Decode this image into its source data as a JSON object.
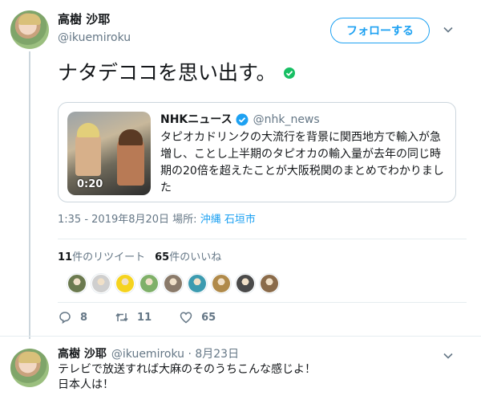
{
  "tweet": {
    "display_name": "高樹 沙耶",
    "handle": "@ikuemiroku",
    "follow_label": "フォローする",
    "text": "ナタデココを思い出す。",
    "meta_time": "1:35 - 2019年8月20日 場所: ",
    "meta_place": "沖縄 石垣市",
    "retweets_count": "11",
    "retweets_label": "件のリツイート",
    "likes_count": "65",
    "likes_label": "件のいいね",
    "reply_count": "8",
    "retweet_count": "11",
    "like_count": "65"
  },
  "quote": {
    "name": "NHKニュース",
    "handle": "@nhk_news",
    "body": "タピオカドリンクの大流行を背景に関西地方で輸入が急増し、ことし上半期のタピオカの輸入量が去年の同じ時期の20倍を超えたことが大阪税関のまとめでわかりました",
    "video_duration": "0:20"
  },
  "likers": [
    "#6b7a4f",
    "#cfcfcf",
    "#f5d31f",
    "#7fb069",
    "#8a7a6a",
    "#3c9bb0",
    "#b08a4a",
    "#4a4a4a",
    "#8a6b4a"
  ],
  "reply": {
    "display_name": "高樹 沙耶",
    "handle_date": "@ikuemiroku · 8月23日",
    "line1": "テレビで放送すれば大麻のそのうちこんな感じよ！",
    "line2": "日本人は！"
  },
  "colors": {
    "accent": "#1da1f2",
    "verified": "#1da1f2",
    "check": "#17bf63",
    "muted": "#657786"
  }
}
